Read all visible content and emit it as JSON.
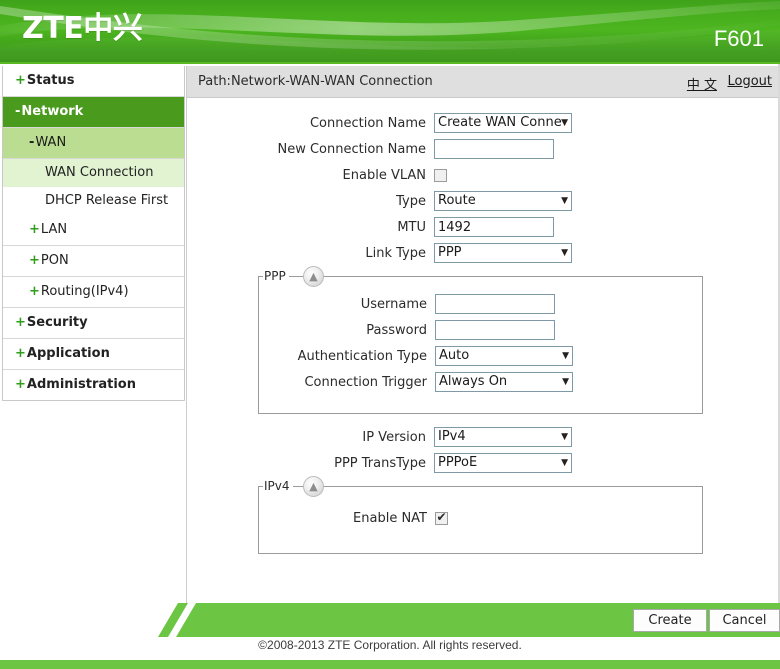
{
  "header": {
    "logo": "ZTE中兴",
    "model": "F601",
    "brand_green": "#4cb51f"
  },
  "sidebar": {
    "items": [
      {
        "label": "Status",
        "marker": "+",
        "level": 0,
        "active": false
      },
      {
        "label": "Network",
        "marker": "-",
        "level": 0,
        "active": true
      },
      {
        "label": "WAN",
        "marker": "-",
        "level": 1,
        "active": true
      },
      {
        "label": "WAN Connection",
        "marker": "",
        "level": 2,
        "active": true
      },
      {
        "label": "DHCP Release First",
        "marker": "",
        "level": 2,
        "active": false
      },
      {
        "label": "LAN",
        "marker": "+",
        "level": 1,
        "active": false
      },
      {
        "label": "PON",
        "marker": "+",
        "level": 1,
        "active": false
      },
      {
        "label": "Routing(IPv4)",
        "marker": "+",
        "level": 1,
        "active": false
      },
      {
        "label": "Security",
        "marker": "+",
        "level": 0,
        "active": false
      },
      {
        "label": "Application",
        "marker": "+",
        "level": 0,
        "active": false
      },
      {
        "label": "Administration",
        "marker": "+",
        "level": 0,
        "active": false
      }
    ]
  },
  "pathbar": {
    "path": "Path:Network-WAN-WAN Connection",
    "language_link": "中 文",
    "logout_link": "Logout"
  },
  "form": {
    "connection_name": {
      "label": "Connection Name",
      "value": "Create WAN Conne"
    },
    "new_connection_name": {
      "label": "New Connection Name",
      "value": "",
      "placeholder": ""
    },
    "enable_vlan": {
      "label": "Enable VLAN",
      "checked": false
    },
    "type": {
      "label": "Type",
      "value": "Route"
    },
    "mtu": {
      "label": "MTU",
      "value": "1492"
    },
    "link_type": {
      "label": "Link Type",
      "value": "PPP"
    },
    "ip_version": {
      "label": "IP Version",
      "value": "IPv4"
    },
    "ppp_transtype": {
      "label": "PPP TransType",
      "value": "PPPoE"
    }
  },
  "ppp_section": {
    "legend": "PPP",
    "toggle_icon": "chevron-up",
    "username": {
      "label": "Username",
      "value": "",
      "placeholder": ""
    },
    "password": {
      "label": "Password",
      "value": "",
      "placeholder": ""
    },
    "authentication_type": {
      "label": "Authentication Type",
      "value": "Auto"
    },
    "connection_trigger": {
      "label": "Connection Trigger",
      "value": "Always On"
    }
  },
  "ipv4_section": {
    "legend": "IPv4",
    "toggle_icon": "chevron-up",
    "enable_nat": {
      "label": "Enable NAT",
      "checked": true
    }
  },
  "footer": {
    "create_label": "Create",
    "cancel_label": "Cancel",
    "copyright": "©2008-2013 ZTE Corporation. All rights reserved."
  }
}
